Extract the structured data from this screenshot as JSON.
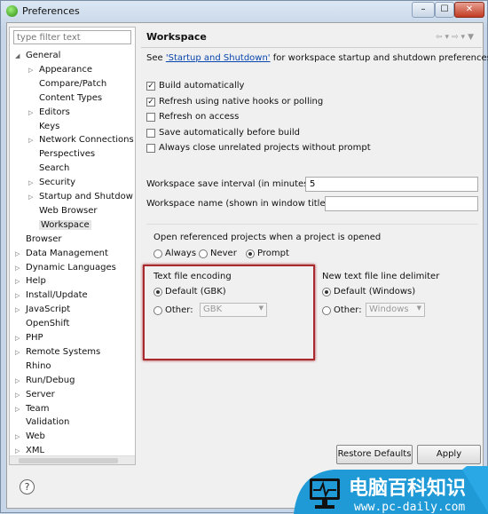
{
  "window": {
    "title": "Preferences",
    "buttons": [
      "minimize",
      "maximize",
      "close"
    ]
  },
  "filter": {
    "placeholder": "type filter text"
  },
  "tree": [
    {
      "label": "General",
      "level": 0,
      "expanded": true
    },
    {
      "label": "Appearance",
      "level": 1,
      "collapsed": true
    },
    {
      "label": "Compare/Patch",
      "level": 1
    },
    {
      "label": "Content Types",
      "level": 1
    },
    {
      "label": "Editors",
      "level": 1,
      "collapsed": true
    },
    {
      "label": "Keys",
      "level": 1
    },
    {
      "label": "Network Connections",
      "level": 1,
      "collapsed": true
    },
    {
      "label": "Perspectives",
      "level": 1
    },
    {
      "label": "Search",
      "level": 1
    },
    {
      "label": "Security",
      "level": 1,
      "collapsed": true
    },
    {
      "label": "Startup and Shutdow",
      "level": 1,
      "collapsed": true
    },
    {
      "label": "Web Browser",
      "level": 1
    },
    {
      "label": "Workspace",
      "level": 1,
      "selected": true
    },
    {
      "label": "Browser",
      "level": 0
    },
    {
      "label": "Data Management",
      "level": 0,
      "collapsed": true
    },
    {
      "label": "Dynamic Languages",
      "level": 0,
      "collapsed": true
    },
    {
      "label": "Help",
      "level": 0,
      "collapsed": true
    },
    {
      "label": "Install/Update",
      "level": 0,
      "collapsed": true
    },
    {
      "label": "JavaScript",
      "level": 0,
      "collapsed": true
    },
    {
      "label": "OpenShift",
      "level": 0
    },
    {
      "label": "PHP",
      "level": 0,
      "collapsed": true
    },
    {
      "label": "Remote Systems",
      "level": 0,
      "collapsed": true
    },
    {
      "label": "Rhino",
      "level": 0
    },
    {
      "label": "Run/Debug",
      "level": 0,
      "collapsed": true
    },
    {
      "label": "Server",
      "level": 0,
      "collapsed": true
    },
    {
      "label": "Team",
      "level": 0,
      "collapsed": true
    },
    {
      "label": "Validation",
      "level": 0
    },
    {
      "label": "Web",
      "level": 0,
      "collapsed": true
    },
    {
      "label": "XML",
      "level": 0,
      "collapsed": true
    }
  ],
  "page": {
    "title": "Workspace",
    "intro_pre": "See ",
    "intro_link": "'Startup and Shutdown'",
    "intro_post": " for workspace startup and shutdown preferences.",
    "checkboxes": [
      {
        "label": "Build automatically",
        "checked": true
      },
      {
        "label": "Refresh using native hooks or polling",
        "checked": true
      },
      {
        "label": "Refresh on access",
        "checked": false
      },
      {
        "label": "Save automatically before build",
        "checked": false
      },
      {
        "label": "Always close unrelated projects without prompt",
        "checked": false
      }
    ],
    "save_interval_label": "Workspace save interval (in minutes):",
    "save_interval_value": "5",
    "ws_name_label": "Workspace name (shown in window title):",
    "ws_name_value": "",
    "open_ref_label": "Open referenced projects when a project is opened",
    "open_ref_options": [
      "Always",
      "Never",
      "Prompt"
    ],
    "open_ref_selected": "Prompt",
    "encoding": {
      "title": "Text file encoding",
      "default_label": "Default (GBK)",
      "other_label": "Other:",
      "other_value": "GBK",
      "selected": "default"
    },
    "delimiter": {
      "title": "New text file line delimiter",
      "default_label": "Default (Windows)",
      "other_label": "Other:",
      "other_value": "Windows",
      "selected": "default"
    },
    "restore_defaults": "Restore Defaults",
    "apply": "Apply"
  },
  "help_icon": "?",
  "watermark": {
    "text": "电脑百科知识",
    "url": "www.pc-daily.com",
    "color": "#1f9ad6"
  }
}
